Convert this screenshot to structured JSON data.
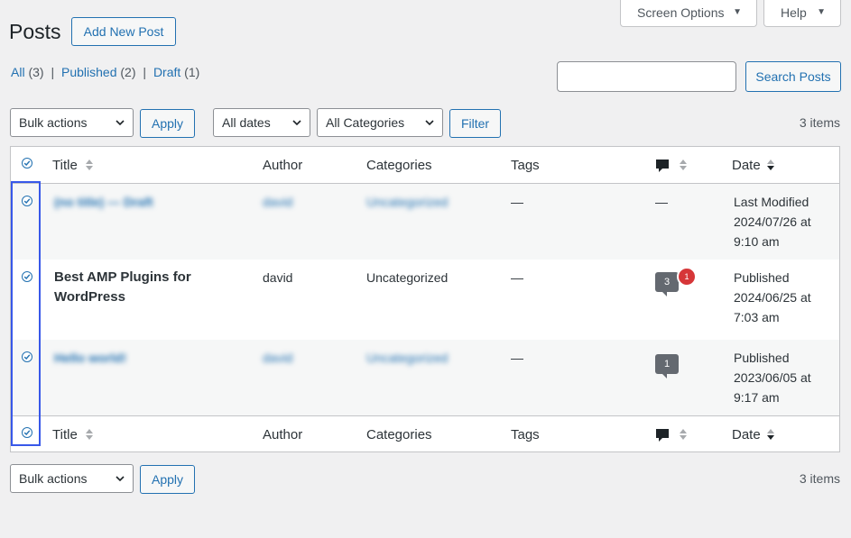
{
  "header": {
    "title": "Posts",
    "add_new": "Add New Post",
    "screen_options": "Screen Options",
    "help": "Help"
  },
  "filters": {
    "all_label": "All",
    "all_count": "(3)",
    "published_label": "Published",
    "published_count": "(2)",
    "draft_label": "Draft",
    "draft_count": "(1)",
    "separator": "|"
  },
  "search": {
    "value": "",
    "button": "Search Posts"
  },
  "tablenav_top": {
    "bulk_actions": "Bulk actions",
    "apply": "Apply",
    "dates": "All dates",
    "categories": "All Categories",
    "filter": "Filter",
    "items": "3 items"
  },
  "columns": {
    "title": "Title",
    "author": "Author",
    "categories": "Categories",
    "tags": "Tags",
    "date": "Date"
  },
  "rows": [
    {
      "title": "(no title) — Draft",
      "author": "david",
      "categories": "Uncategorized",
      "tags": "—",
      "comments": "—",
      "date_status": "Last Modified",
      "date_day": "2024/07/26 at",
      "date_time": "9:10 am"
    },
    {
      "title_line1": "Best AMP Plugins for",
      "title_line2": "WordPress",
      "author": "david",
      "categories": "Uncategorized",
      "tags": "—",
      "comments": "3",
      "pending": "1",
      "date_status": "Published",
      "date_day": "2024/06/25 at",
      "date_time": "7:03 am"
    },
    {
      "title": "Hello world!",
      "author": "david",
      "categories": "Uncategorized",
      "tags": "—",
      "comments": "1",
      "date_status": "Published",
      "date_day": "2023/06/05 at",
      "date_time": "9:17 am"
    }
  ],
  "tablenav_bottom": {
    "bulk_actions": "Bulk actions",
    "apply": "Apply",
    "items": "3 items"
  },
  "colors": {
    "link": "#2271b1",
    "highlight_border": "#3858e9",
    "pending_badge": "#d63638",
    "comment_bubble": "#646970"
  }
}
